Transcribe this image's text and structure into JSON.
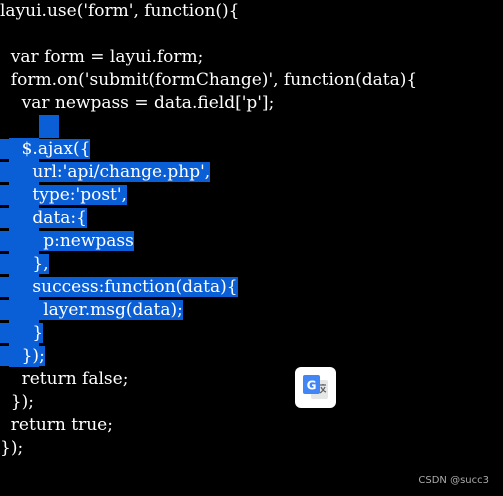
{
  "code_lines": [
    "layui.use('form', function(){",
    "",
    "  var form = layui.form;",
    "  form.on('submit(formChange)', function(data){",
    "    var newpass = data.field['p'];",
    "",
    "    $.ajax({",
    "      url:'api/change.php',",
    "      type:'post',",
    "      data:{",
    "        p:newpass",
    "      },",
    "      success:function(data){",
    "        layer.msg(data);",
    "      }",
    "    });",
    "    return false;",
    "  });",
    "  return true;",
    "});"
  ],
  "translate_button": {
    "icon": "google-translate-icon",
    "letters": "G"
  },
  "watermark": "CSDN @succ3",
  "colors": {
    "background": "#000000",
    "text": "#ffffff",
    "selection": "#0a5fd6"
  }
}
